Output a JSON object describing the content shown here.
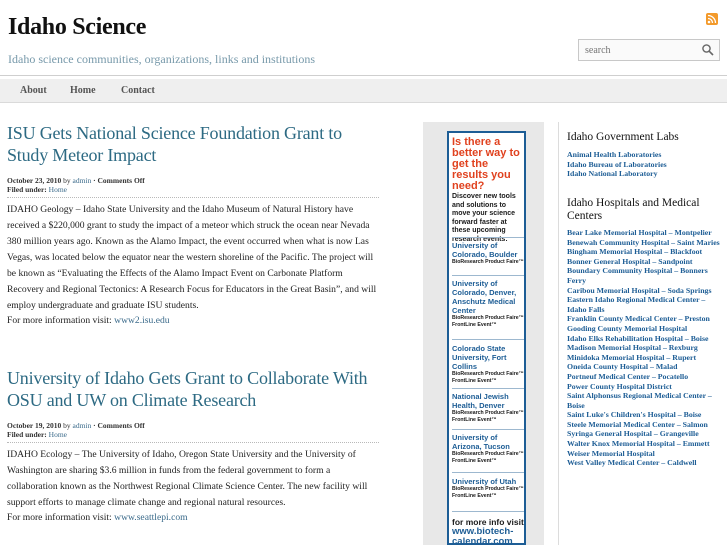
{
  "header": {
    "site_title": "Idaho Science",
    "tagline": "Idaho science communities, organizations, links and institutions",
    "search_placeholder": "search"
  },
  "nav": {
    "items": [
      {
        "label": "About"
      },
      {
        "label": "Home"
      },
      {
        "label": "Contact"
      }
    ]
  },
  "posts": [
    {
      "title": "ISU Gets National Science Foundation Grant to Study Meteor Impact",
      "date": "October 23, 2010",
      "by": "by",
      "author": "admin",
      "comments": "· Comments Off",
      "filed_label": "Filed under:",
      "category": "Home",
      "body": "IDAHO Geology – Idaho State University and the Idaho Museum of Natural History have received a $220,000 grant to study the impact of a meteor which struck the ocean near Nevada 380 million years ago. Known as the Alamo Impact, the event occurred when what is now Las Vegas, was located below the equator near the western shoreline of the Pacific. The project will be known as “Evaluating the Effects of the Alamo Impact Event on Carbonate Platform Recovery and Regional Tectonics: A Research Focus for Educators in the Great Basin”, and will employ undergraduate and graduate ISU students.",
      "more_label": "For more information visit:",
      "more_link": "www2.isu.edu"
    },
    {
      "title": "University of Idaho Gets Grant to Collaborate With OSU and UW on Climate Research",
      "date": "October 19, 2010",
      "by": "by",
      "author": "admin",
      "comments": "· Comments Off",
      "filed_label": "Filed under:",
      "category": "Home",
      "body": "IDAHO Ecology – The University of Idaho, Oregon State University and the University of Washington are sharing $3.6 million in funds from the federal government to form a collaboration known as the Northwest Regional Climate Science Center. The new facility will support efforts to manage climate change and regional natural resources.",
      "more_label": "For more information visit:",
      "more_link": "www.seattlepi.com"
    }
  ],
  "ad": {
    "headline": "Is there a better way to get the results you need?",
    "intro": "Discover new tools and solutions to move your science forward faster at these upcoming research events:",
    "items": [
      {
        "name": "University of Colorado, Boulder",
        "sub": "BioResearch Product Faire™"
      },
      {
        "name": "University of Colorado, Denver, Anschutz Medical Center",
        "sub": "BioResearch Product Faire™\nFrontLine Event™"
      },
      {
        "name": "Colorado State University, Fort Collins",
        "sub": "BioResearch Product Faire™\nFrontLine Event™"
      },
      {
        "name": "National Jewish Health, Denver",
        "sub": "BioResearch Product Faire™\nFrontLine Event™"
      },
      {
        "name": "University of Arizona, Tucson",
        "sub": "BioResearch Product Faire™\nFrontLine Event™"
      },
      {
        "name": "University of Utah",
        "sub": "BioResearch Product Faire™\nFrontLine Event™"
      }
    ],
    "footer_text": "for more info visit",
    "footer_url": "www.biotech-calendar.com"
  },
  "sidebar": {
    "labs_title": "Idaho Government Labs",
    "labs": [
      "Animal Health Laboratories",
      "Idaho Bureau of Laboratories",
      "Idaho National Laboratory"
    ],
    "hospitals_title": "Idaho Hospitals and Medical Centers",
    "hospitals": [
      "Bear Lake Memorial Hospital – Montpelier",
      "Benewah Community Hospital – Saint Maries",
      "Bingham Memorial Hospital – Blackfoot",
      "Bonner General Hospital – Sandpoint",
      "Boundary Community Hospital – Bonners Ferry",
      "Caribou Memorial Hospital – Soda Springs",
      "Eastern Idaho Regional Medical Center – Idaho Falls",
      "Franklin County Medical Center – Preston",
      "Gooding County Memorial Hospital",
      "Idaho Elks Rehabilitation Hospital – Boise",
      "Madison Memorial Hospital – Rexburg",
      "Minidoka Memorial Hospital – Rupert",
      "Oneida County Hospital – Malad",
      "Portneuf Medical Center – Pocatello",
      "Power County Hospital District",
      "Saint Alphonsus Regional Medical Center – Boise",
      "Saint Luke's Children's Hospital – Boise",
      "Steele Memorial Medical Center – Salmon",
      "Syringa General Hospital – Grangeville",
      "Walter Knox Memorial Hospital – Emmett",
      "Weiser Memorial Hospital",
      "West Valley Medical Center – Caldwell"
    ]
  },
  "colors": {
    "title_blue": "#2d6a83",
    "link_blue": "#1d5d95",
    "ad_red": "#e0421f",
    "rss_orange": "#f39a2b"
  }
}
